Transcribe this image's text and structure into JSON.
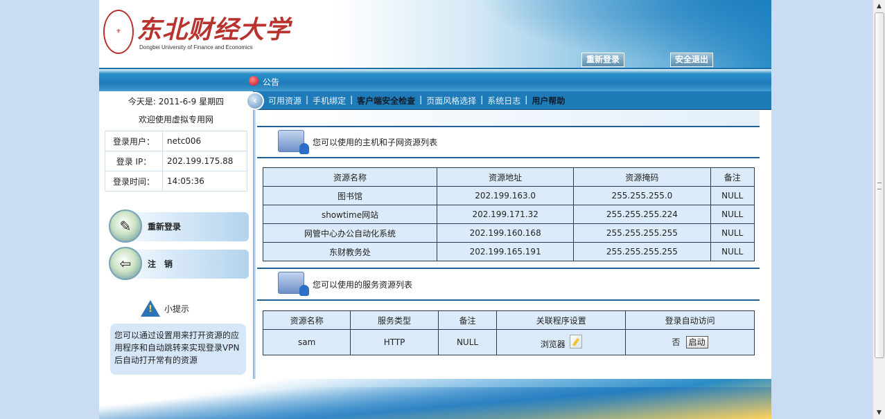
{
  "header": {
    "logo_cn": "东北财经大学",
    "logo_en": "Dongbei University of Finance and Economics",
    "relogin": "重新登录",
    "logout": "安全退出",
    "notice": "公告"
  },
  "nav": {
    "items": [
      {
        "label": "可用资源",
        "active": false
      },
      {
        "label": "手机绑定",
        "active": false
      },
      {
        "label": "客户端安全检查",
        "active": true
      },
      {
        "label": "页面风格选择",
        "active": false
      },
      {
        "label": "系统日志",
        "active": false
      },
      {
        "label": "用户帮助",
        "active": true
      }
    ],
    "separator": "|"
  },
  "left": {
    "today": "今天是: 2011-6-9 星期四",
    "welcome": "欢迎使用虚拟专用网",
    "user_label": "登录用户：",
    "user_value": "netc006",
    "ip_label": "登录 IP：",
    "ip_value": "202.199.175.88",
    "time_label": "登录时间：",
    "time_value": "14:05:36",
    "relogin_button": "重新登录",
    "logout_button": "注　销",
    "tips_title": "小提示",
    "tips_text": "您可以通过设置用来打开资源的应用程序和自动跳转来实现登录VPN后自动打开常有的资源"
  },
  "hosts": {
    "title": "您可以使用的主机和子网资源列表",
    "headers": [
      "资源名称",
      "资源地址",
      "资源掩码",
      "备注"
    ],
    "rows": [
      [
        "图书馆",
        "202.199.163.0",
        "255.255.255.0",
        "NULL"
      ],
      [
        "showtime网站",
        "202.199.171.32",
        "255.255.255.224",
        "NULL"
      ],
      [
        "网管中心办公自动化系统",
        "202.199.160.168",
        "255.255.255.255",
        "NULL"
      ],
      [
        "东财教务处",
        "202.199.165.191",
        "255.255.255.255",
        "NULL"
      ]
    ]
  },
  "services": {
    "title": "您可以使用的服务资源列表",
    "headers": [
      "资源名称",
      "服务类型",
      "备注",
      "关联程序设置",
      "登录自动访问"
    ],
    "rows": [
      {
        "name": "sam",
        "type": "HTTP",
        "note": "NULL",
        "app": "浏览器",
        "auto": "否",
        "start_button": "启动"
      }
    ]
  }
}
